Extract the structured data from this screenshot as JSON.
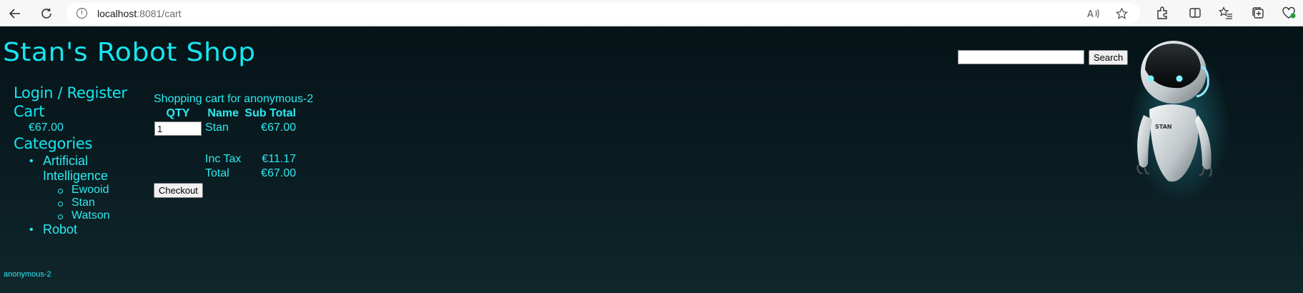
{
  "browser": {
    "url_host": "localhost",
    "url_path": ":8081/cart"
  },
  "shop": {
    "title": "Stan's Robot Shop"
  },
  "search": {
    "value": "",
    "button_label": "Search"
  },
  "nav": {
    "login_label": "Login / Register",
    "cart_label": "Cart",
    "cart_total": "€67.00",
    "categories_label": "Categories",
    "categories": [
      {
        "label": "Artificial Intelligence",
        "items": [
          "Ewooid",
          "Stan",
          "Watson"
        ]
      },
      {
        "label": "Robot",
        "items": []
      }
    ]
  },
  "cart": {
    "heading": "Shopping cart for anonymous-2",
    "columns": [
      "QTY",
      "Name",
      "Sub Total"
    ],
    "rows": [
      {
        "qty": "1",
        "name": "Stan",
        "subtotal": "€67.00"
      }
    ],
    "tax_label": "Inc Tax",
    "tax_value": "€11.17",
    "total_label": "Total",
    "total_value": "€67.00",
    "checkout_label": "Checkout"
  },
  "user": {
    "name": "anonymous-2"
  },
  "robot_badge": "STAN",
  "colors": {
    "accent": "#16e6f0",
    "background": "#0a1d22"
  }
}
